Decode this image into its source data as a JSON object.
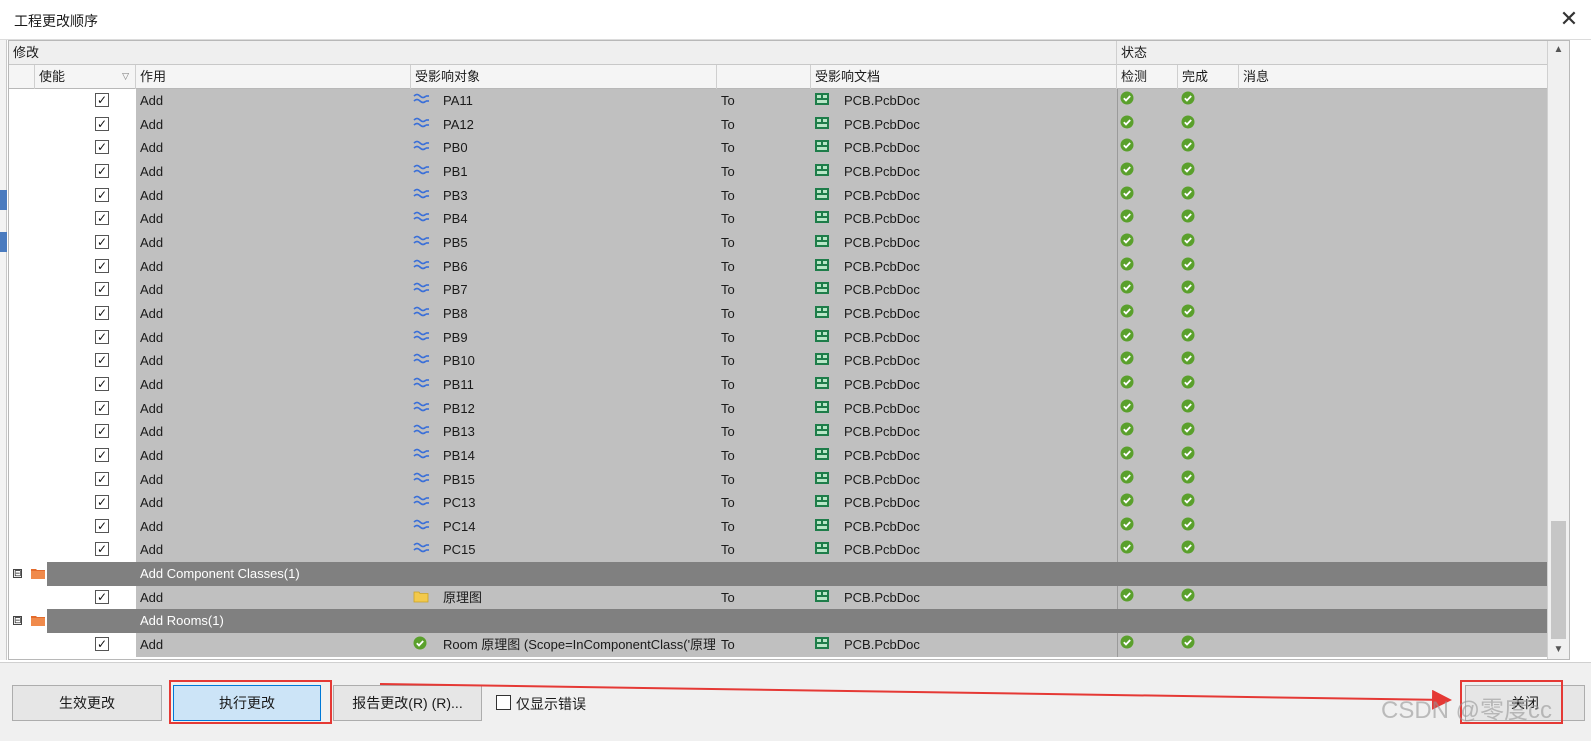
{
  "window": {
    "title": "工程更改顺序",
    "close": "✕"
  },
  "header": {
    "group_modify": "修改",
    "group_status": "状态",
    "col_enable": "使能",
    "col_action": "作用",
    "col_object": "受影响对象",
    "col_doc": "受影响文档",
    "col_check": "检测",
    "col_done": "完成",
    "col_msg": "消息"
  },
  "rows_before": [
    {
      "action": "Add",
      "object": "PA11",
      "to": "To",
      "doc": "PCB.PcbDoc"
    },
    {
      "action": "Add",
      "object": "PA12",
      "to": "To",
      "doc": "PCB.PcbDoc"
    },
    {
      "action": "Add",
      "object": "PB0",
      "to": "To",
      "doc": "PCB.PcbDoc"
    },
    {
      "action": "Add",
      "object": "PB1",
      "to": "To",
      "doc": "PCB.PcbDoc"
    },
    {
      "action": "Add",
      "object": "PB3",
      "to": "To",
      "doc": "PCB.PcbDoc"
    },
    {
      "action": "Add",
      "object": "PB4",
      "to": "To",
      "doc": "PCB.PcbDoc"
    },
    {
      "action": "Add",
      "object": "PB5",
      "to": "To",
      "doc": "PCB.PcbDoc"
    },
    {
      "action": "Add",
      "object": "PB6",
      "to": "To",
      "doc": "PCB.PcbDoc"
    },
    {
      "action": "Add",
      "object": "PB7",
      "to": "To",
      "doc": "PCB.PcbDoc"
    },
    {
      "action": "Add",
      "object": "PB8",
      "to": "To",
      "doc": "PCB.PcbDoc"
    },
    {
      "action": "Add",
      "object": "PB9",
      "to": "To",
      "doc": "PCB.PcbDoc"
    },
    {
      "action": "Add",
      "object": "PB10",
      "to": "To",
      "doc": "PCB.PcbDoc"
    },
    {
      "action": "Add",
      "object": "PB11",
      "to": "To",
      "doc": "PCB.PcbDoc"
    },
    {
      "action": "Add",
      "object": "PB12",
      "to": "To",
      "doc": "PCB.PcbDoc"
    },
    {
      "action": "Add",
      "object": "PB13",
      "to": "To",
      "doc": "PCB.PcbDoc"
    },
    {
      "action": "Add",
      "object": "PB14",
      "to": "To",
      "doc": "PCB.PcbDoc"
    },
    {
      "action": "Add",
      "object": "PB15",
      "to": "To",
      "doc": "PCB.PcbDoc"
    },
    {
      "action": "Add",
      "object": "PC13",
      "to": "To",
      "doc": "PCB.PcbDoc"
    },
    {
      "action": "Add",
      "object": "PC14",
      "to": "To",
      "doc": "PCB.PcbDoc"
    },
    {
      "action": "Add",
      "object": "PC15",
      "to": "To",
      "doc": "PCB.PcbDoc"
    }
  ],
  "group_classes": {
    "label": "Add Component Classes(1)",
    "expander": "⊟"
  },
  "row_class": {
    "action": "Add",
    "object": "原理图",
    "to": "To",
    "doc": "PCB.PcbDoc"
  },
  "group_rooms": {
    "label": "Add Rooms(1)",
    "expander": "⊟"
  },
  "row_room": {
    "action": "Add",
    "object": "Room 原理图 (Scope=InComponentClass('原理",
    "to": "To",
    "doc": "PCB.PcbDoc"
  },
  "footer": {
    "validate": "生效更改",
    "execute": "执行更改",
    "report": "报告更改(R) (R)...",
    "only_errors": "仅显示错误",
    "close": "关闭"
  },
  "watermark": "CSDN @零度cc",
  "colors": {
    "ok": "#5aa02c",
    "highlight": "#e53935",
    "row_gray": "#c0c0c0",
    "group_gray": "#808080"
  }
}
